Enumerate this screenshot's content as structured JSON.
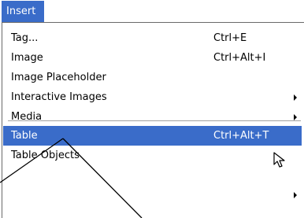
{
  "menubar": {
    "title": "Insert"
  },
  "menu": {
    "items": [
      {
        "label": "Tag...",
        "shortcut": "Ctrl+E"
      },
      {
        "label": "Image",
        "shortcut": "Ctrl+Alt+I"
      },
      {
        "label": "Image Placeholder",
        "shortcut": ""
      },
      {
        "label": "Interactive Images",
        "shortcut": "",
        "submenu": true
      },
      {
        "label": "Media",
        "shortcut": "",
        "submenu": true
      },
      {
        "label": "Table",
        "shortcut": "Ctrl+Alt+T",
        "highlighted": true
      },
      {
        "label": "Table Objects",
        "shortcut": ""
      }
    ]
  },
  "colors": {
    "highlight": "#3a6cc9",
    "menu_background": "#ffffff"
  },
  "icons": {
    "cursor": "mouse-pointer-icon",
    "submenu": "submenu-arrow-icon"
  }
}
